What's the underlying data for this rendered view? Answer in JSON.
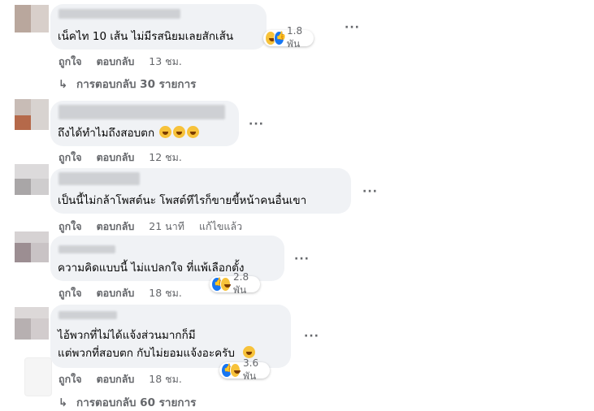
{
  "comments": [
    {
      "text": "เน็คไท 10 เส้น ไม่มีรสนิยมเลยสักเส้น",
      "like": "ถูกใจ",
      "reply": "ตอบกลับ",
      "time": "13 ชม.",
      "reaction_count": "1.8 พัน",
      "replies_label": "การตอบกลับ 30 รายการ"
    },
    {
      "text": "ถึงได้ทำไมถึงสอบตก",
      "like": "ถูกใจ",
      "reply": "ตอบกลับ",
      "time": "12 ชม."
    },
    {
      "text": "เป็นนี้ไม่กล้าโพสต์นะ โพสต์ทีไรก็ขายขี้หน้าคนอื่นเขา",
      "like": "ถูกใจ",
      "reply": "ตอบกลับ",
      "time": "21 นาที",
      "edited": "แก้ไขแล้ว"
    },
    {
      "text": "ความคิดแบบนี้ ไม่แปลกใจ ที่แพ้เลือกตั้ง",
      "like": "ถูกใจ",
      "reply": "ตอบกลับ",
      "time": "18 ชม.",
      "reaction_count": "2.8 พัน"
    },
    {
      "text_line1": "ไอ้พวกที่ไม่ได้แจ้งส่วนมากก็มี",
      "text_line2": "แต่พวกที่สอบตก กับไม่ยอมแจ้งอะครับ",
      "like": "ถูกใจ",
      "reply": "ตอบกลับ",
      "time": "18 ชม.",
      "reaction_count": "3.6 พัน",
      "replies_label": "การตอบกลับ 60 รายการ"
    }
  ],
  "more_glyph": "···",
  "reply_arrow": "↳",
  "colors": {
    "bubble": "#f0f2f5",
    "meta": "#65676b",
    "like_blue": "#1877f2",
    "haha_yellow": "#f7c23a"
  }
}
